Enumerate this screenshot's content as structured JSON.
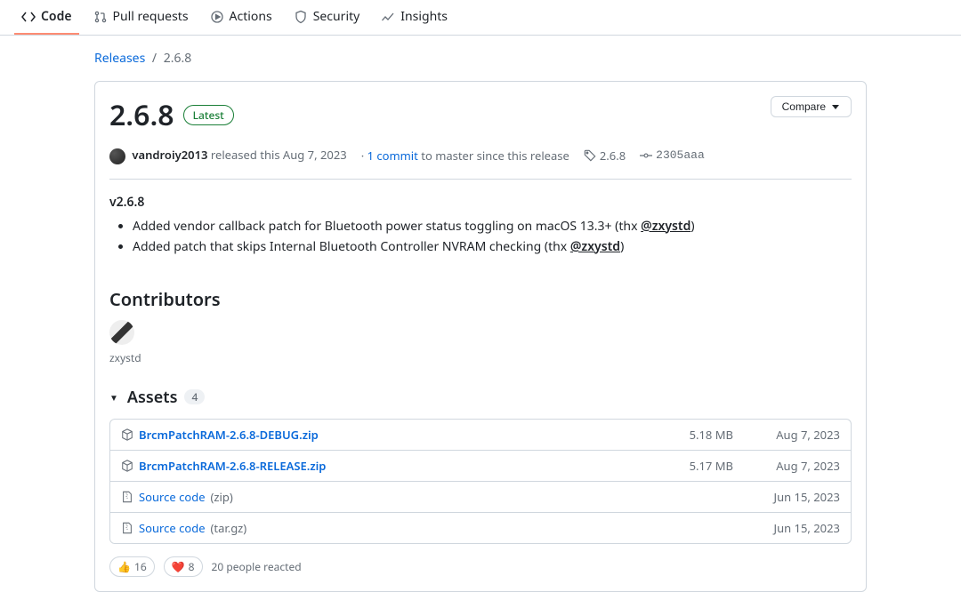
{
  "nav": {
    "items": [
      {
        "label": "Code",
        "selected": true
      },
      {
        "label": "Pull requests",
        "selected": false
      },
      {
        "label": "Actions",
        "selected": false
      },
      {
        "label": "Security",
        "selected": false
      },
      {
        "label": "Insights",
        "selected": false
      }
    ]
  },
  "breadcrumb": {
    "root": "Releases",
    "separator": "/",
    "current": "2.6.8"
  },
  "release": {
    "title": "2.6.8",
    "latest_label": "Latest",
    "compare_label": "Compare",
    "author": "vandroiy2013",
    "released_text": "released this Aug 7, 2023",
    "commits_prefix": "·",
    "commits_link": "1 commit",
    "commits_suffix": "to master since this release",
    "tag": "2.6.8",
    "commit_sha": "2305aaa"
  },
  "body": {
    "version_header": "v2.6.8",
    "items": [
      {
        "text": "Added vendor callback patch for Bluetooth power status toggling on macOS 13.3+ (thx ",
        "mention": "@zxystd",
        "suffix": ")"
      },
      {
        "text": "Added patch that skips Internal Bluetooth Controller NVRAM checking (thx ",
        "mention": "@zxystd",
        "suffix": ")"
      }
    ]
  },
  "contributors": {
    "heading": "Contributors",
    "people": [
      {
        "name": "zxystd"
      }
    ]
  },
  "assets": {
    "heading": "Assets",
    "count": "4",
    "rows": [
      {
        "name": "BrcmPatchRAM-2.6.8-DEBUG.zip",
        "kind": "package",
        "size": "5.18 MB",
        "date": "Aug 7, 2023"
      },
      {
        "name": "BrcmPatchRAM-2.6.8-RELEASE.zip",
        "kind": "package",
        "size": "5.17 MB",
        "date": "Aug 7, 2023"
      },
      {
        "name": "Source code",
        "ext": "(zip)",
        "kind": "archive",
        "size": "",
        "date": "Jun 15, 2023"
      },
      {
        "name": "Source code",
        "ext": "(tar.gz)",
        "kind": "archive",
        "size": "",
        "date": "Jun 15, 2023"
      }
    ]
  },
  "reactions": {
    "thumbsup": "16",
    "heart": "8",
    "summary": "20 people reacted"
  }
}
